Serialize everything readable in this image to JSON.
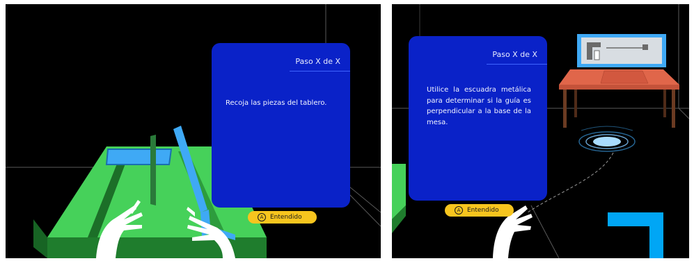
{
  "colors": {
    "card_bg": "#0a22c8",
    "accent_yellow": "#f7c51e",
    "table_green": "#46d15a",
    "guide_blue": "#3fa9f5",
    "desk_orange": "#e0664a"
  },
  "panels": [
    {
      "card": {
        "step": "Paso X de X",
        "instruction": "Recoja las piezas del tablero."
      },
      "confirm_button": {
        "key_icon": "A",
        "label": "Entendido"
      }
    },
    {
      "card": {
        "step": "Paso X de X",
        "instruction": "Utilice la escuadra metálica para determinar si la guía es perpendicular a la base de la mesa."
      },
      "confirm_button": {
        "key_icon": "A",
        "label": "Entendido"
      }
    }
  ]
}
